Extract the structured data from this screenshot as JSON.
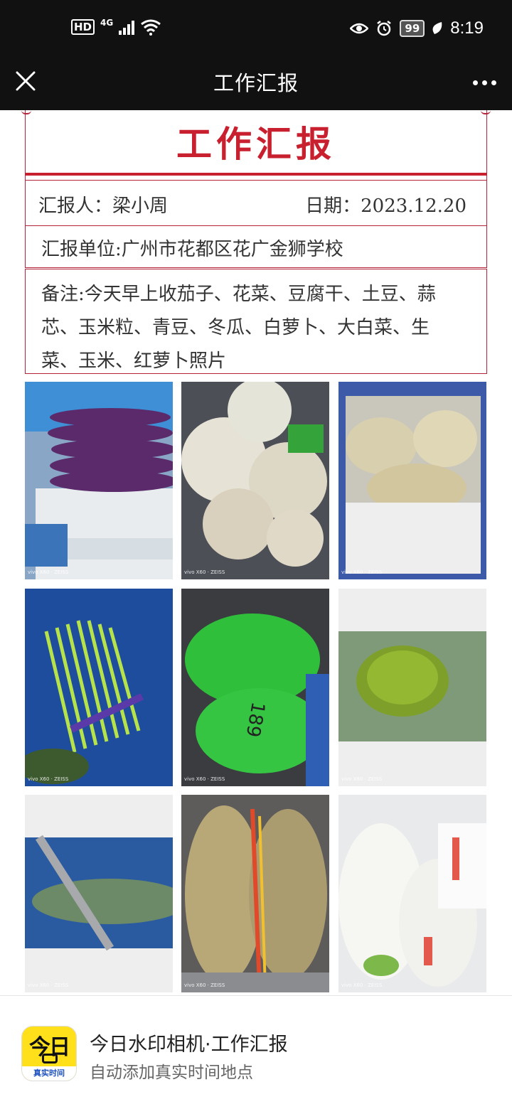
{
  "status_bar": {
    "hd": "HD",
    "network": "4G",
    "battery": "99",
    "time": "8:19"
  },
  "title_bar": {
    "title": "工作汇报"
  },
  "report": {
    "heading": "工作汇报",
    "reporter_text": "汇报人：梁小周",
    "date_text": "日期：2023.12.20",
    "unit_text": "汇报单位:广州市花都区花广金狮学校",
    "note_text": "备注:今天早上收茄子、花菜、豆腐干、土豆、蒜芯、玉米粒、青豆、冬瓜、白萝卜、大白菜、生菜、玉米、红萝卜照片"
  },
  "photos": [
    {
      "subject": "eggplant",
      "watermark": "vivo X60 · ZEISS"
    },
    {
      "subject": "cauliflower",
      "watermark": "vivo X60 · ZEISS"
    },
    {
      "subject": "tofu",
      "watermark": "vivo X60 · ZEISS"
    },
    {
      "subject": "garlic-shoots",
      "watermark": "vivo X60 · ZEISS"
    },
    {
      "subject": "corn-kernels-bags",
      "watermark": "vivo X60 · ZEISS"
    },
    {
      "subject": "green-peas",
      "watermark": "vivo X60 · ZEISS"
    },
    {
      "subject": "winter-melon",
      "watermark": "vivo X60 · ZEISS"
    },
    {
      "subject": "potatoes",
      "watermark": "vivo X60 · ZEISS"
    },
    {
      "subject": "white-radish",
      "watermark": "vivo X60 · ZEISS"
    }
  ],
  "app_card": {
    "icon_text": "今日",
    "icon_tag": "真实时间",
    "name": "今日水印相机·工作汇报",
    "description": "自动添加真实时间地点"
  },
  "colors": {
    "accent_red": "#c8202f",
    "bar_bg": "#111111"
  }
}
